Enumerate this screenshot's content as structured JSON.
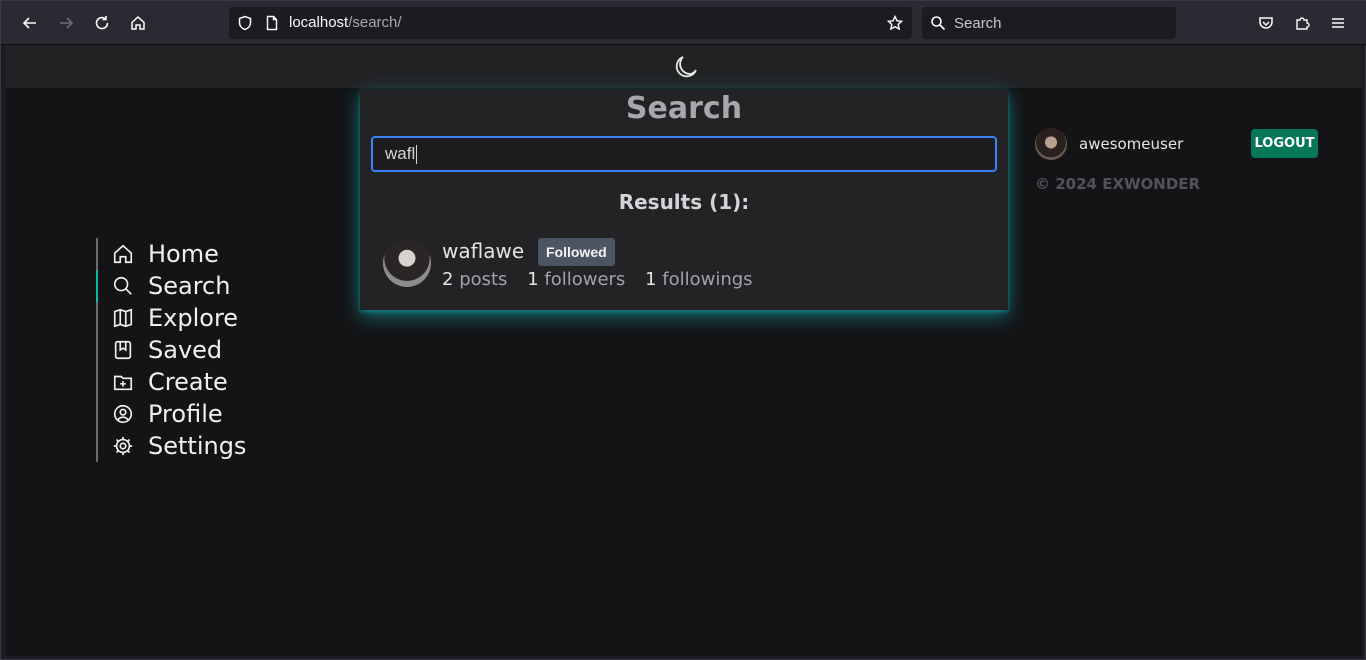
{
  "browser": {
    "url_host": "localhost",
    "url_path": "/search/",
    "search_placeholder": "Search"
  },
  "sidebar": {
    "items": [
      {
        "label": "Home",
        "icon": "home-icon"
      },
      {
        "label": "Search",
        "icon": "search-icon",
        "active": true
      },
      {
        "label": "Explore",
        "icon": "map-icon"
      },
      {
        "label": "Saved",
        "icon": "bookmark-icon"
      },
      {
        "label": "Create",
        "icon": "folder-plus-icon"
      },
      {
        "label": "Profile",
        "icon": "user-circle-icon"
      },
      {
        "label": "Settings",
        "icon": "gear-icon"
      }
    ]
  },
  "search": {
    "title": "Search",
    "query": "wafl",
    "results_heading": "Results (1):",
    "results": [
      {
        "username": "waflawe",
        "badge": "Followed",
        "posts_count": "2",
        "posts_label": "posts",
        "followers_count": "1",
        "followers_label": "followers",
        "followings_count": "1",
        "followings_label": "followings"
      }
    ]
  },
  "user": {
    "username": "awesomeuser",
    "logout_label": "LOGOUT"
  },
  "footer": {
    "copyright": "© 2024 EXWONDER"
  },
  "colors": {
    "accent_teal": "#14b8a6",
    "input_focus": "#3b82f6",
    "logout_green": "#047857",
    "badge_gray": "#4b5563"
  }
}
